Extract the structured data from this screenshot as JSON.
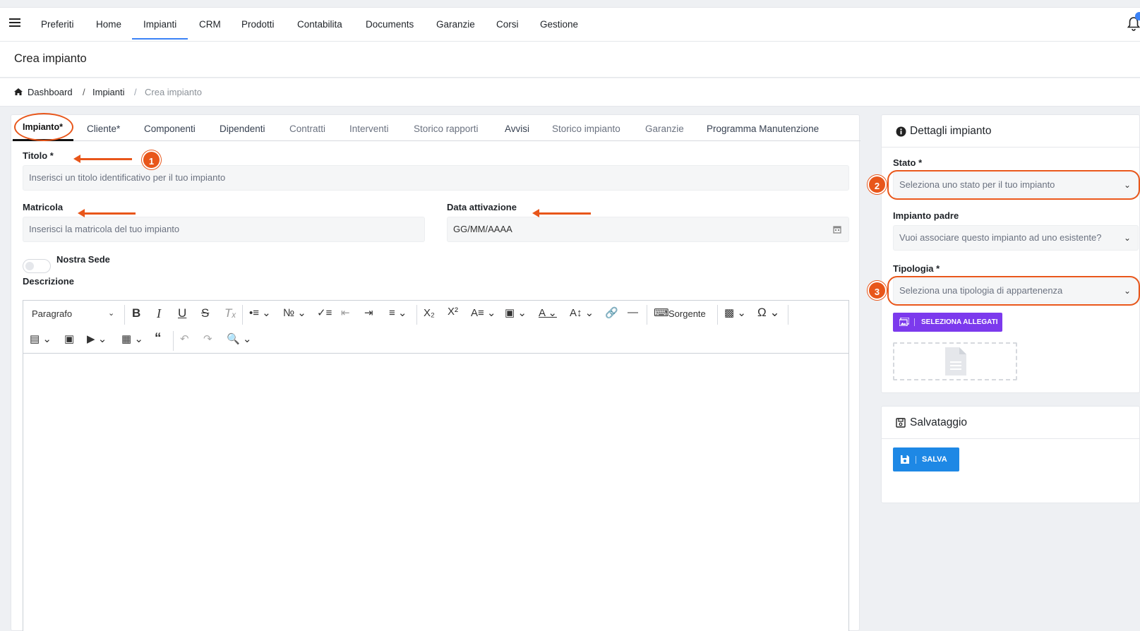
{
  "nav": {
    "items": [
      "Preferiti",
      "Home",
      "Impianti",
      "CRM",
      "Prodotti",
      "Contabilita",
      "Documents",
      "Garanzie",
      "Corsi",
      "Gestione"
    ],
    "active": "Impianti"
  },
  "page": {
    "title": "Crea impianto"
  },
  "breadcrumb": {
    "home": "Dashboard",
    "sep1": "/",
    "section": "Impianti",
    "sep2": "/",
    "current": "Crea impianto"
  },
  "tabs": [
    "Impianto*",
    "Cliente*",
    "Componenti",
    "Dipendenti",
    "Contratti",
    "Interventi",
    "Storico rapporti",
    "Avvisi",
    "Storico impianto",
    "Garanzie",
    "Programma Manutenzione"
  ],
  "form": {
    "titolo_label": "Titolo *",
    "titolo_placeholder": "Inserisci un titolo identificativo per il tuo impianto",
    "matricola_label": "Matricola",
    "matricola_placeholder": "Inserisci la matricola del tuo impianto",
    "data_label": "Data attivazione",
    "data_placeholder": "GG/MM/AAAA",
    "nostra_sede_label": "Nostra Sede",
    "descrizione_label": "Descrizione"
  },
  "editor": {
    "paragraph_select": "Paragrafo",
    "source_label": "Sorgente"
  },
  "details": {
    "title": "Dettagli impianto",
    "stato_label": "Stato *",
    "stato_placeholder": "Seleziona uno stato per il tuo impianto",
    "padre_label": "Impianto padre",
    "padre_placeholder": "Vuoi associare questo impianto ad uno esistente?",
    "tipologia_label": "Tipologia *",
    "tipologia_placeholder": "Seleziona una tipologia di appartenenza",
    "attachments_button": "SELEZIONA ALLEGATI"
  },
  "save": {
    "title": "Salvataggio",
    "button": "SALVA"
  },
  "annotations": {
    "one": "1",
    "two": "2",
    "three": "3",
    "color": "#e8561a"
  }
}
